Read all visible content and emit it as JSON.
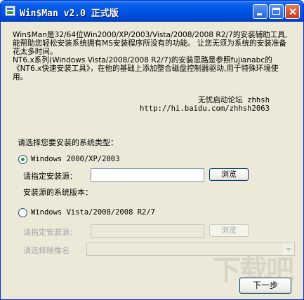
{
  "window": {
    "title": "Win$Man v2.0 正式版"
  },
  "intro_text": "Win$Man是32/64位Win2000/XP/2003/Vista/2008/2008 R2/7的安装辅助工具,能帮助您轻松安装系统拥有MS安装程序所没有的功能。 让您无须为系统的安装准备花太多时间。\nNT6.x系列(Windows Vista/2008/2008 R2/7)的安装思路是参照fujianabc的《NT6.x快速安装工具》，在他的基础上添加整合磁盘控制器驱动,用于特殊环境使用。",
  "credit": {
    "forum": "无忧启动论坛 zhhsh",
    "url": "http://hi.baidu.com/zhhsh2063"
  },
  "install_type_label": "请选择您要安装的系统类型：",
  "option_xp": {
    "label": "Windows 2000/XP/2003",
    "checked": true,
    "source_label": "请指定安装源：",
    "source_value": "",
    "browse": "浏览",
    "version_label": "安装源的系统版本："
  },
  "option_vista": {
    "label": "Windows Vista/2008/2008 R2/7",
    "checked": false,
    "source_label": "请指定安装源：",
    "source_value": "",
    "browse": "浏览",
    "image_label": "请选择映像名",
    "image_value": ""
  },
  "next_button": "下一步",
  "watermark": "下载吧",
  "colors": {
    "titlebar": "#0055e5",
    "face": "#ece9d8",
    "disabled_text": "#a7a6aa",
    "radio_dot": "#21a121"
  }
}
